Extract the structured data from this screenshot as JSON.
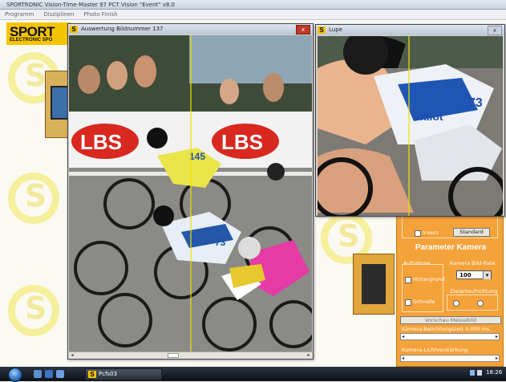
{
  "app": {
    "title": "SPORTRONIC Vision-Time-Master 97 PCT Vision \"Event\" v8.0",
    "menu": [
      "Programm",
      "Disziplinen",
      "Photo Finish"
    ],
    "brand_main": "SPORT",
    "brand_sub": "ELECTRONIC SPO"
  },
  "auswertung": {
    "title": "Auswertung   Bildnummer 137",
    "close": "x",
    "banner_text": "LBS",
    "bib_a": "145",
    "bib_b": "73"
  },
  "lupe": {
    "title": "Lupe",
    "close": "x",
    "bib": "73",
    "jersey_text": "skilot"
  },
  "parameter": {
    "invers_label": "Invers",
    "standard_button": "Standard",
    "header": "Parameter Kamera",
    "aufnahme_label": "Aufnahme",
    "option_hintergrund": "Hintergrund",
    "option_schnelle": "Schnelle",
    "bildrate_label": "Kamera Bild-Rate",
    "bildrate_value": "100",
    "zielanlage_label": "Zielanlaufrichtung",
    "vorschau_button": "Vorschau Messabild",
    "belichtung_label": "Kamera-Belichtungszeit 0.000 ms",
    "lichtverstaerkung_label": "Kamera-Lichtverstärkung"
  },
  "taskbar": {
    "task_label": "Pcfs03",
    "clock": "18:26"
  },
  "colors": {
    "brand_yellow": "#f5c400",
    "panel_orange": "#f4a23a",
    "cursor_line": "#f0e000"
  },
  "icons": [
    "start-orb-icon",
    "s-app-icon",
    "close-icon",
    "volume-icon",
    "network-icon"
  ]
}
